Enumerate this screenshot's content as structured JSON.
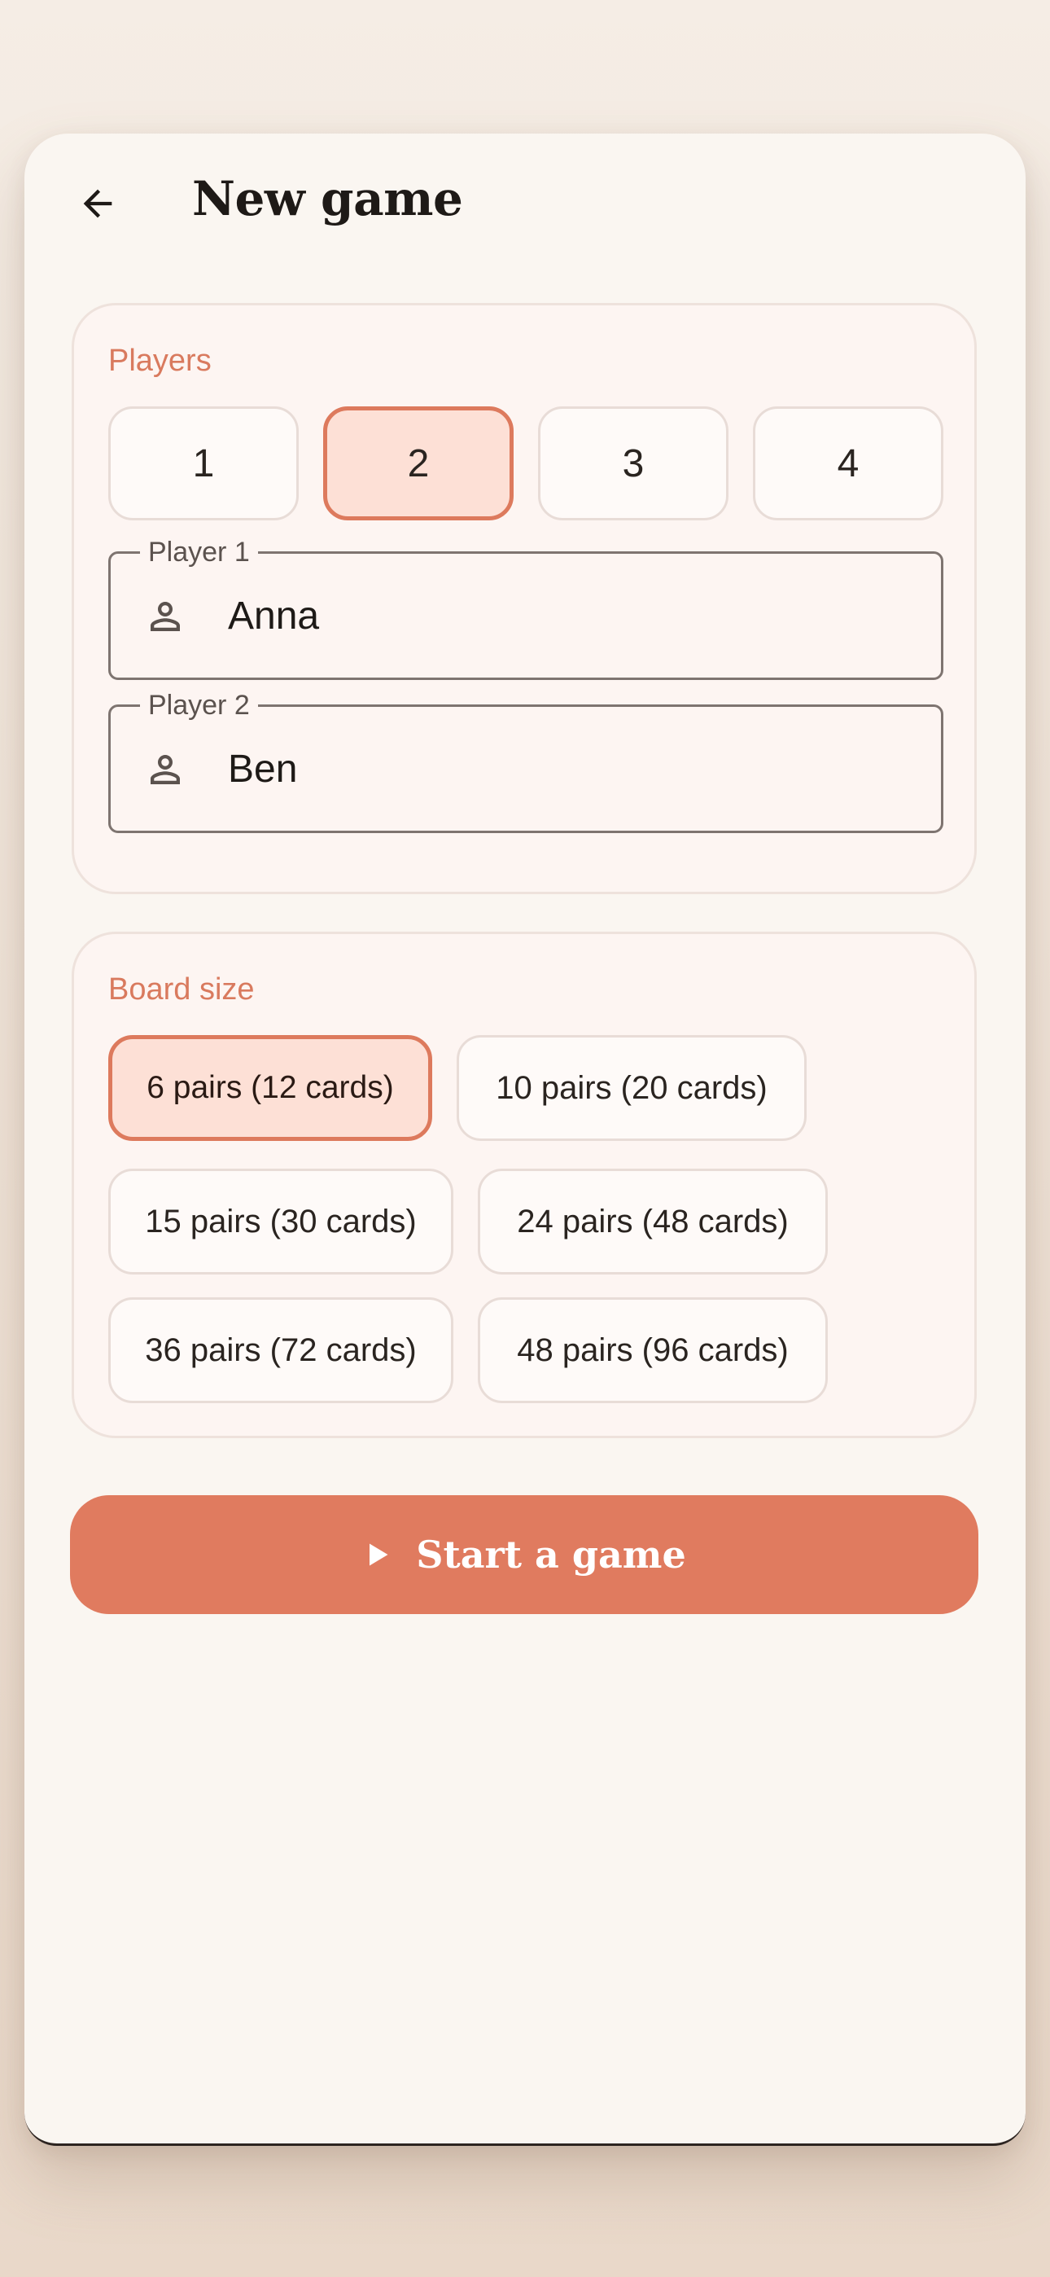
{
  "colors": {
    "accent": "#e07b5f",
    "accent_soft": "#fde0d6",
    "label": "#d97a5e",
    "surface": "#faf6f1"
  },
  "header": {
    "back_icon": "arrow-left-icon",
    "title": "New game"
  },
  "players": {
    "section_label": "Players",
    "count_options": [
      "1",
      "2",
      "3",
      "4"
    ],
    "selected_count": "2",
    "fields": [
      {
        "label": "Player 1",
        "icon": "person-icon",
        "value": "Anna"
      },
      {
        "label": "Player 2",
        "icon": "person-icon",
        "value": "Ben"
      }
    ]
  },
  "board": {
    "section_label": "Board size",
    "options": [
      "6 pairs (12 cards)",
      "10 pairs (20 cards)",
      "15 pairs (30 cards)",
      "24 pairs (48 cards)",
      "36 pairs (72 cards)",
      "48 pairs (96 cards)"
    ],
    "selected": "6 pairs (12 cards)"
  },
  "start_button": {
    "icon": "play-icon",
    "label": "Start a game"
  }
}
